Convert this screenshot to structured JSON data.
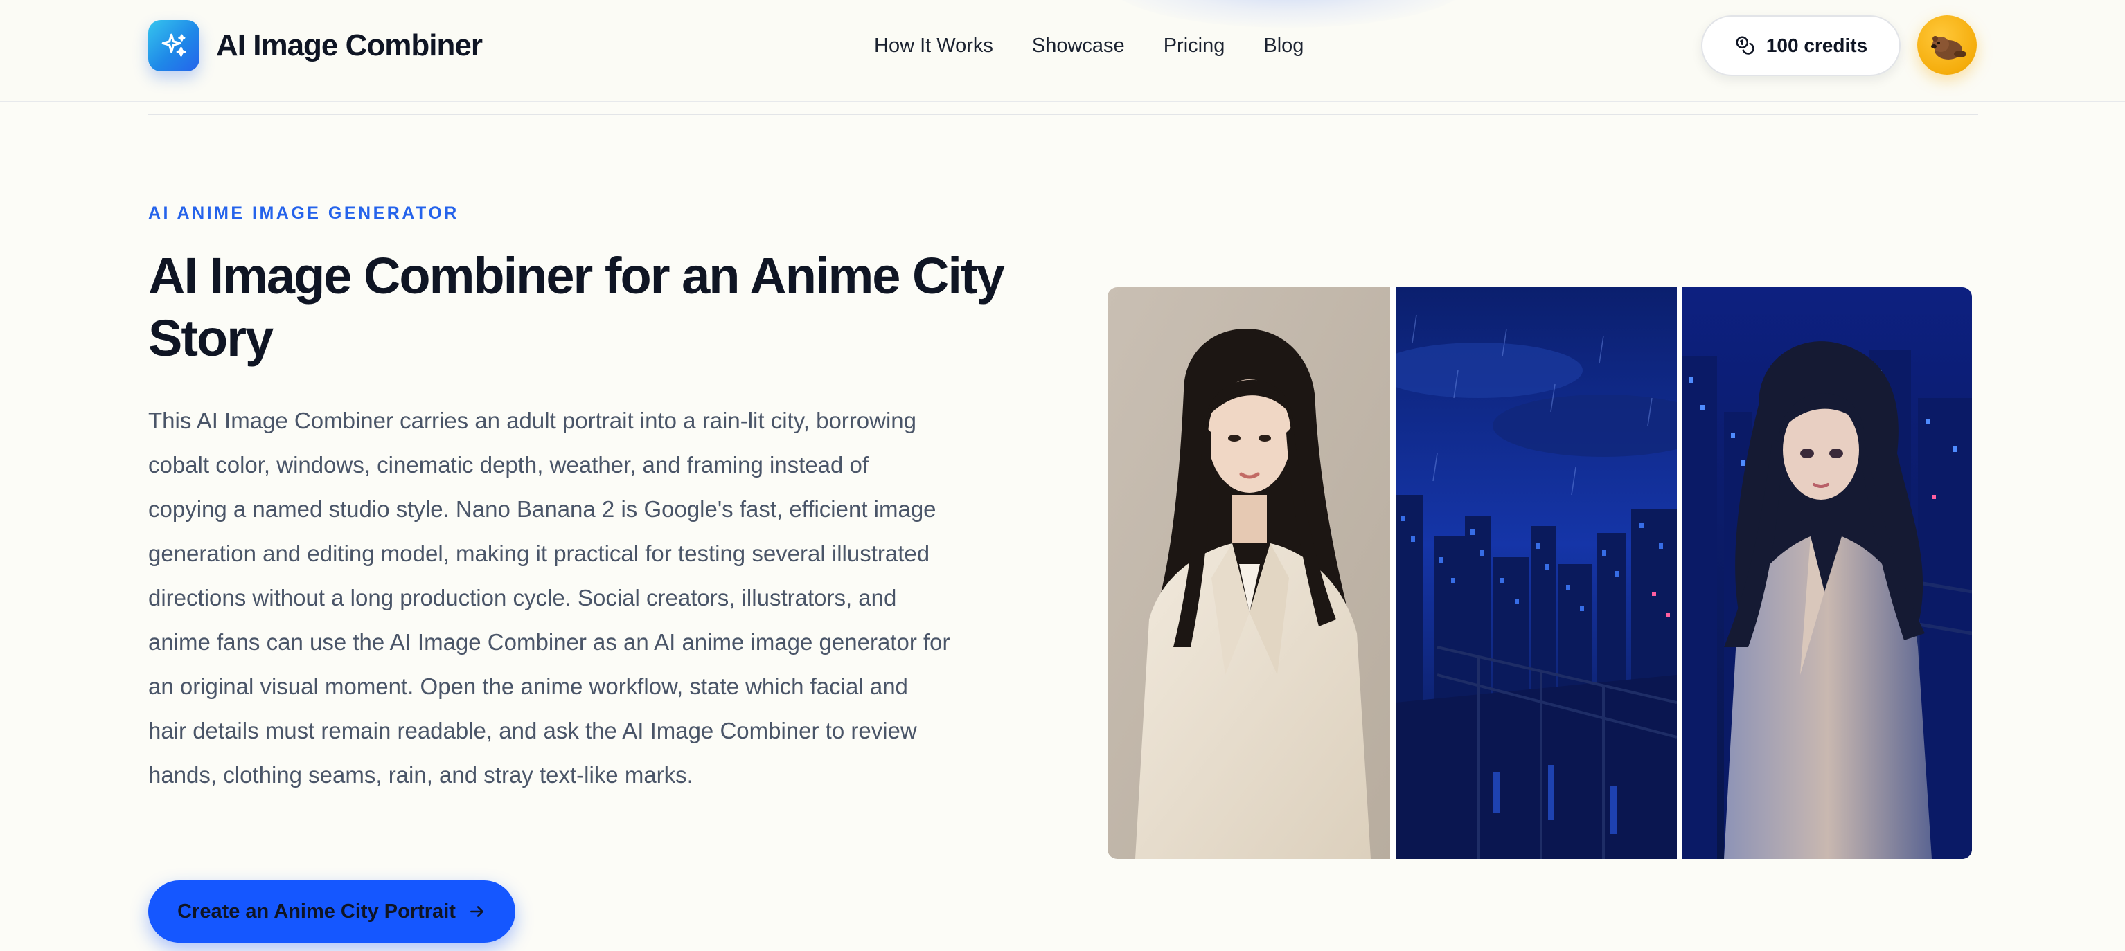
{
  "header": {
    "brand": {
      "name": "AI Image Combiner",
      "logo_icon": "sparkles-icon",
      "accent": "#2563eb"
    },
    "nav": [
      {
        "label": "How It Works"
      },
      {
        "label": "Showcase"
      },
      {
        "label": "Pricing"
      },
      {
        "label": "Blog"
      }
    ],
    "credits": {
      "label": "100 credits",
      "icon": "coins-icon"
    },
    "avatar": {
      "icon": "beaver-avatar-icon",
      "color": "#f5ad0c"
    }
  },
  "hero": {
    "eyebrow": "AI ANIME IMAGE GENERATOR",
    "title": "AI Image Combiner for an Anime City Story",
    "body": "This AI Image Combiner carries an adult portrait into a rain-lit city, borrowing cobalt color, windows, cinematic depth, weather, and framing instead of copying a named studio style. Nano Banana 2 is Google's fast, efficient image generation and editing model, making it practical for testing several illustrated directions without a long production cycle. Social creators, illustrators, and anime fans can use the AI Image Combiner as an AI anime image generator for an original visual moment. Open the anime workflow, state which facial and hair details must remain readable, and ask the AI Image Combiner to review hands, clothing seams, rain, and stray text-like marks.",
    "cta": {
      "label": "Create an Anime City Portrait",
      "icon": "arrow-right-icon",
      "color": "#1557ff"
    }
  },
  "images": [
    {
      "role": "input-portrait"
    },
    {
      "role": "input-rainy-city"
    },
    {
      "role": "output-anime-portrait"
    }
  ]
}
